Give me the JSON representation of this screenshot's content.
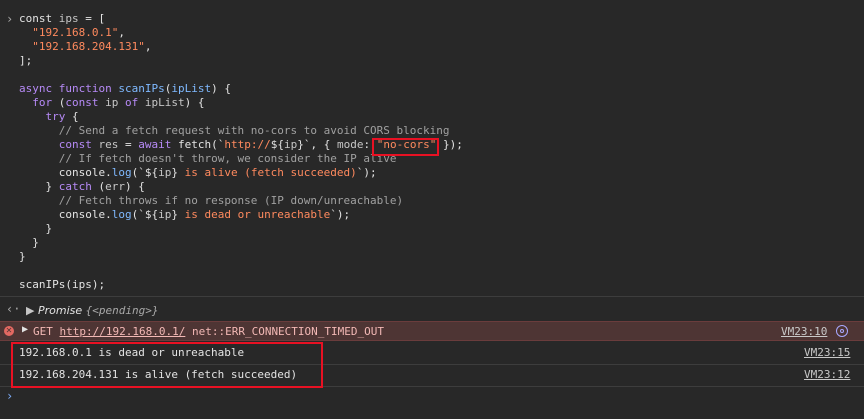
{
  "code_lines": [
    [
      [
        "pl",
        "const "
      ],
      [
        "var",
        "ips"
      ],
      [
        "pl",
        " = ["
      ]
    ],
    [
      [
        "pl",
        "  "
      ],
      [
        "str",
        "\"192.168.0.1\""
      ],
      [
        "pl",
        ","
      ]
    ],
    [
      [
        "pl",
        "  "
      ],
      [
        "str",
        "\"192.168.204.131\""
      ],
      [
        "pl",
        ","
      ]
    ],
    [
      [
        "pl",
        "];"
      ]
    ],
    [],
    [
      [
        "kw",
        "async "
      ],
      [
        "kw",
        "function "
      ],
      [
        "fn",
        "scanIPs"
      ],
      [
        "pl",
        "("
      ],
      [
        "fn",
        "ipList"
      ],
      [
        "pl",
        ") {"
      ]
    ],
    [
      [
        "pl",
        "  "
      ],
      [
        "kw",
        "for "
      ],
      [
        "pl",
        "("
      ],
      [
        "kw",
        "const "
      ],
      [
        "var",
        "ip "
      ],
      [
        "kw",
        "of "
      ],
      [
        "var",
        "ipList"
      ],
      [
        "pl",
        ") {"
      ]
    ],
    [
      [
        "pl",
        "    "
      ],
      [
        "kw",
        "try "
      ],
      [
        "pl",
        "{"
      ]
    ],
    [
      [
        "pl",
        "      "
      ],
      [
        "cm",
        "// Send a fetch request with no-cors to avoid CORS blocking"
      ]
    ],
    [
      [
        "pl",
        "      "
      ],
      [
        "kw",
        "const "
      ],
      [
        "var",
        "res"
      ],
      [
        "pl",
        " = "
      ],
      [
        "kw",
        "await "
      ],
      [
        "pl",
        "fetch(`"
      ],
      [
        "str",
        "http://"
      ],
      [
        "pl",
        "${"
      ],
      [
        "var",
        "ip"
      ],
      [
        "pl",
        "}`"
      ],
      [
        "pl",
        ", { "
      ],
      [
        "var",
        "mode"
      ],
      [
        "pl",
        ": "
      ],
      [
        "str",
        "\"no-cors\""
      ],
      [
        "pl",
        " });"
      ]
    ],
    [
      [
        "pl",
        "      "
      ],
      [
        "cm",
        "// If fetch doesn't throw, we consider the IP alive"
      ]
    ],
    [
      [
        "pl",
        "      console."
      ],
      [
        "fn",
        "log"
      ],
      [
        "pl",
        "(`${"
      ],
      [
        "var",
        "ip"
      ],
      [
        "pl",
        "} "
      ],
      [
        "str",
        "is alive (fetch succeeded)"
      ],
      [
        "pl",
        "`);"
      ]
    ],
    [
      [
        "pl",
        "    } "
      ],
      [
        "kw",
        "catch "
      ],
      [
        "pl",
        "("
      ],
      [
        "var",
        "err"
      ],
      [
        "pl",
        ") {"
      ]
    ],
    [
      [
        "pl",
        "      "
      ],
      [
        "cm",
        "// Fetch throws if no response (IP down/unreachable)"
      ]
    ],
    [
      [
        "pl",
        "      console."
      ],
      [
        "fn",
        "log"
      ],
      [
        "pl",
        "(`${"
      ],
      [
        "var",
        "ip"
      ],
      [
        "pl",
        "} "
      ],
      [
        "str",
        "is dead or unreachable"
      ],
      [
        "pl",
        "`);"
      ]
    ],
    [
      [
        "pl",
        "    }"
      ]
    ],
    [
      [
        "pl",
        "  }"
      ]
    ],
    [
      [
        "pl",
        "}"
      ]
    ],
    [],
    [
      [
        "pl",
        "scanIPs(ips);"
      ]
    ]
  ],
  "result": {
    "label": "Promise ",
    "value": "{<pending>}"
  },
  "error": {
    "method": "GET",
    "url": "http://192.168.0.1/",
    "message": "net::ERR_CONNECTION_TIMED_OUT",
    "source": "VM23:10"
  },
  "logs": [
    {
      "text": "192.168.0.1 is dead or unreachable",
      "source": "VM23:15"
    },
    {
      "text": "192.168.204.131 is alive (fetch succeeded)",
      "source": "VM23:12"
    }
  ],
  "icons": {
    "input_prompt": "chevron-right-icon",
    "result": "return-arrow-icon",
    "error": "error-circle-icon",
    "network": "network-request-icon"
  },
  "colors": {
    "highlight": "#e81123",
    "error_bg": "#4e3534"
  }
}
